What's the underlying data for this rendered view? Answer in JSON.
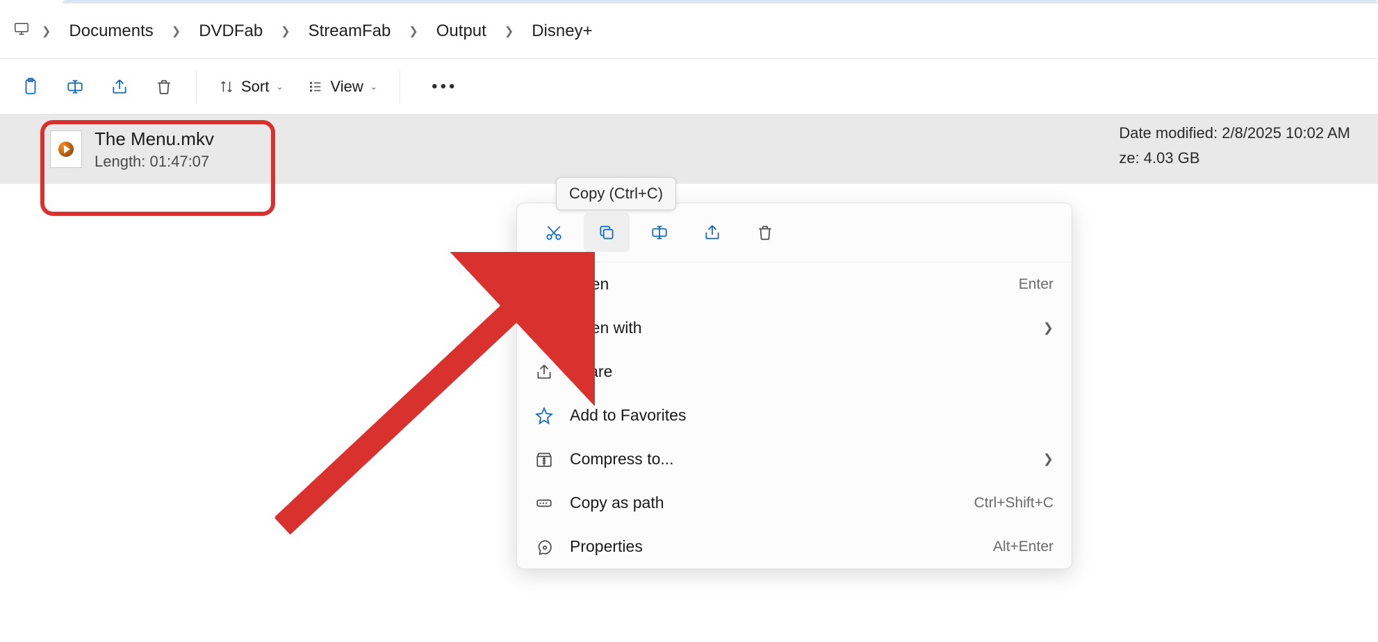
{
  "breadcrumbs": [
    "Documents",
    "DVDFab",
    "StreamFab",
    "Output",
    "Disney+"
  ],
  "toolbar": {
    "sort_label": "Sort",
    "view_label": "View"
  },
  "file": {
    "name": "The Menu.mkv",
    "length_label": "Length: 01:47:07",
    "date_modified": "Date modified: 2/8/2025 10:02 AM",
    "size": "ze: 4.03 GB"
  },
  "tooltip": "Copy (Ctrl+C)",
  "context_menu": {
    "items": [
      {
        "label": "Open",
        "shortcut": "Enter",
        "submenu": false
      },
      {
        "label": "Open with",
        "shortcut": "",
        "submenu": true
      },
      {
        "label": "Share",
        "shortcut": "",
        "submenu": false
      },
      {
        "label": "Add to Favorites",
        "shortcut": "",
        "submenu": false
      },
      {
        "label": "Compress to...",
        "shortcut": "",
        "submenu": true
      },
      {
        "label": "Copy as path",
        "shortcut": "Ctrl+Shift+C",
        "submenu": false
      },
      {
        "label": "Properties",
        "shortcut": "Alt+Enter",
        "submenu": false
      }
    ]
  }
}
